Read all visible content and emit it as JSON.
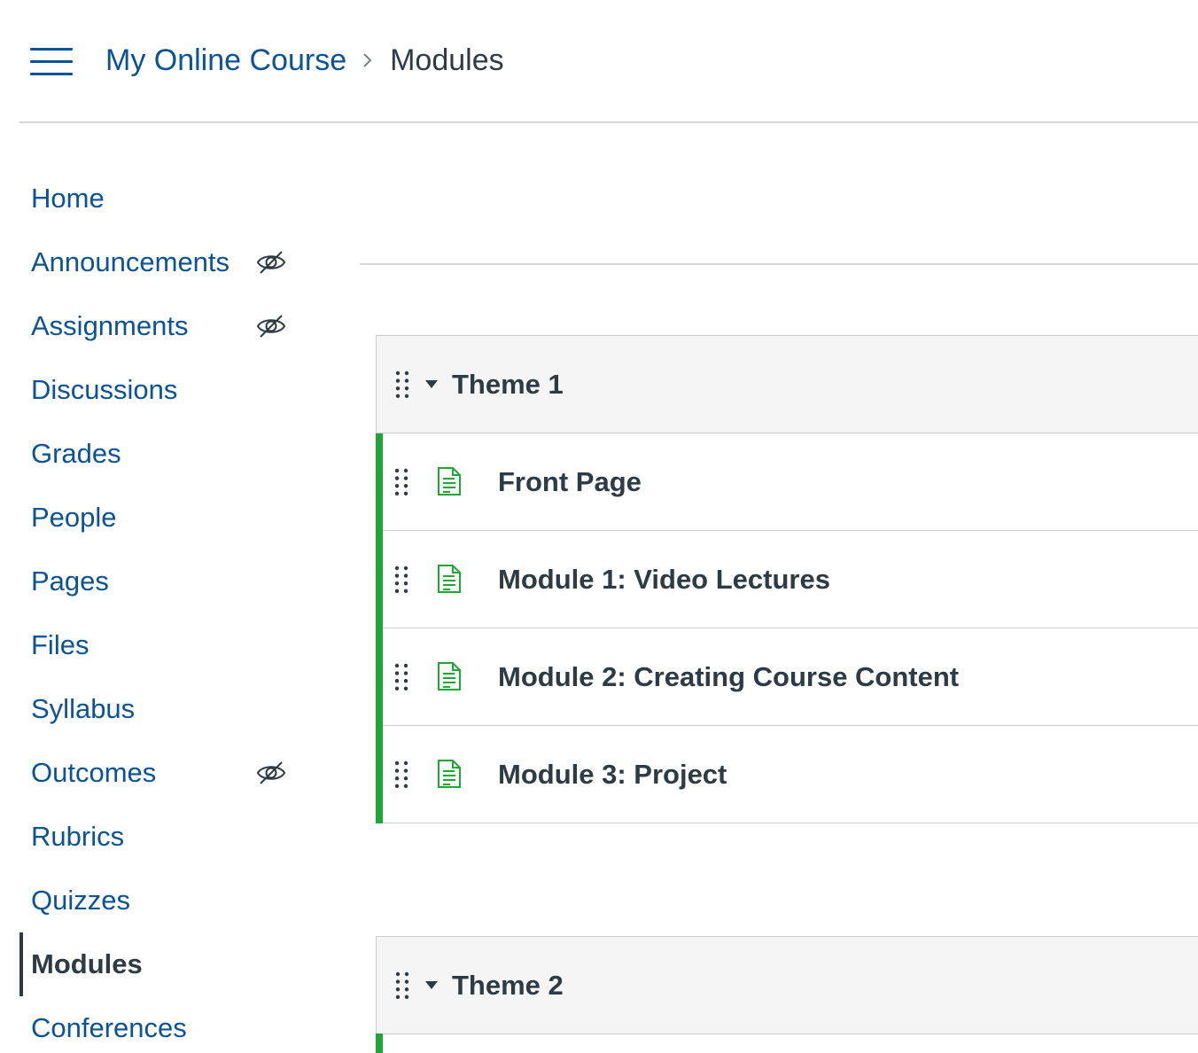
{
  "header": {
    "menu_icon": "hamburger-icon",
    "breadcrumb": {
      "course": "My Online Course",
      "separator_icon": "chevron-right-icon",
      "current": "Modules"
    }
  },
  "sidebar": {
    "items": [
      {
        "label": "Home",
        "hidden": false,
        "active": false
      },
      {
        "label": "Announcements",
        "hidden": true,
        "active": false
      },
      {
        "label": "Assignments",
        "hidden": true,
        "active": false
      },
      {
        "label": "Discussions",
        "hidden": false,
        "active": false
      },
      {
        "label": "Grades",
        "hidden": false,
        "active": false
      },
      {
        "label": "People",
        "hidden": false,
        "active": false
      },
      {
        "label": "Pages",
        "hidden": false,
        "active": false
      },
      {
        "label": "Files",
        "hidden": false,
        "active": false
      },
      {
        "label": "Syllabus",
        "hidden": false,
        "active": false
      },
      {
        "label": "Outcomes",
        "hidden": true,
        "active": false
      },
      {
        "label": "Rubrics",
        "hidden": false,
        "active": false
      },
      {
        "label": "Quizzes",
        "hidden": false,
        "active": false
      },
      {
        "label": "Modules",
        "hidden": false,
        "active": true
      },
      {
        "label": "Conferences",
        "hidden": false,
        "active": false
      }
    ],
    "hidden_icon": "eye-slash-icon"
  },
  "modules": [
    {
      "title": "Theme 1",
      "items": [
        {
          "title": "Front Page",
          "icon": "page-icon"
        },
        {
          "title": "Module 1: Video Lectures",
          "icon": "page-icon"
        },
        {
          "title": "Module 2: Creating Course Content",
          "icon": "page-icon"
        },
        {
          "title": "Module 3: Project",
          "icon": "page-icon"
        }
      ]
    },
    {
      "title": "Theme 2",
      "items": []
    }
  ],
  "colors": {
    "link": "#0b5394",
    "text": "#2d3b45",
    "published_green": "#1fa637",
    "module_header_bg": "#f5f5f5",
    "border": "#c7cdd1"
  }
}
